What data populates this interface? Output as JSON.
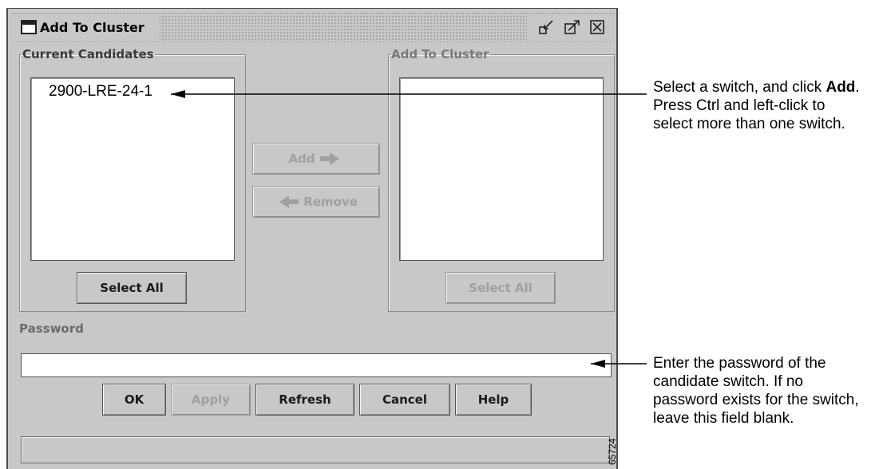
{
  "window": {
    "title": "Add To Cluster",
    "icons": [
      "minimize-icon",
      "maximize-icon",
      "close-icon"
    ]
  },
  "current_candidates": {
    "legend": "Current Candidates",
    "items": [
      "2900-LRE-24-1"
    ],
    "select_all_label": "Select All"
  },
  "add_to_cluster": {
    "legend": "Add To Cluster",
    "items": [],
    "select_all_label": "Select All"
  },
  "transfer": {
    "add_label": "Add",
    "remove_label": "Remove"
  },
  "password": {
    "label": "Password",
    "value": ""
  },
  "buttons": {
    "ok": "OK",
    "apply": "Apply",
    "refresh": "Refresh",
    "cancel": "Cancel",
    "help": "Help"
  },
  "callouts": {
    "select_lead": "Select a switch, and click",
    "select_bold": "Add",
    "select_rest": ". Press Ctrl and left-click to select more than one switch.",
    "password_note": "Enter the password of the candidate switch. If no password exists for the switch, leave this field blank."
  },
  "figure_number": "65724",
  "colors": {
    "dialog_bg": "#c8c8c8",
    "disabled_text": "#a0a0a0"
  }
}
